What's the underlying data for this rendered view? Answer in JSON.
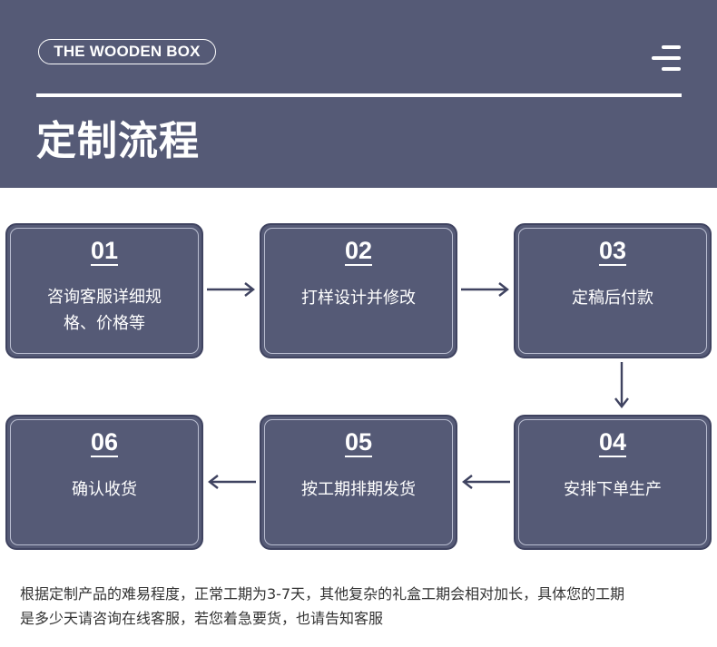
{
  "header": {
    "brand": "THE WOODEN BOX",
    "title": "定制流程",
    "menu_icon": "menu-icon"
  },
  "colors": {
    "header_bg": "#555a76",
    "card_bg": "#555a76",
    "arrow": "#3f4360",
    "text_light": "#ffffff",
    "text_dark": "#333333"
  },
  "steps": [
    {
      "num": "01",
      "line1": "咨询客服详细规",
      "line2": "格、价格等"
    },
    {
      "num": "02",
      "line1": "打样设计并修改",
      "line2": ""
    },
    {
      "num": "03",
      "line1": "定稿后付款",
      "line2": ""
    },
    {
      "num": "04",
      "line1": "安排下单生产",
      "line2": ""
    },
    {
      "num": "05",
      "line1": "按工期排期发货",
      "line2": ""
    },
    {
      "num": "06",
      "line1": "确认收货",
      "line2": ""
    }
  ],
  "note": {
    "line1": "根据定制产品的难易程度，正常工期为3-7天，其他复杂的礼盒工期会相对加长，具体您的工期",
    "line2": "是多少天请咨询在线客服，若您着急要货，也请告知客服"
  }
}
